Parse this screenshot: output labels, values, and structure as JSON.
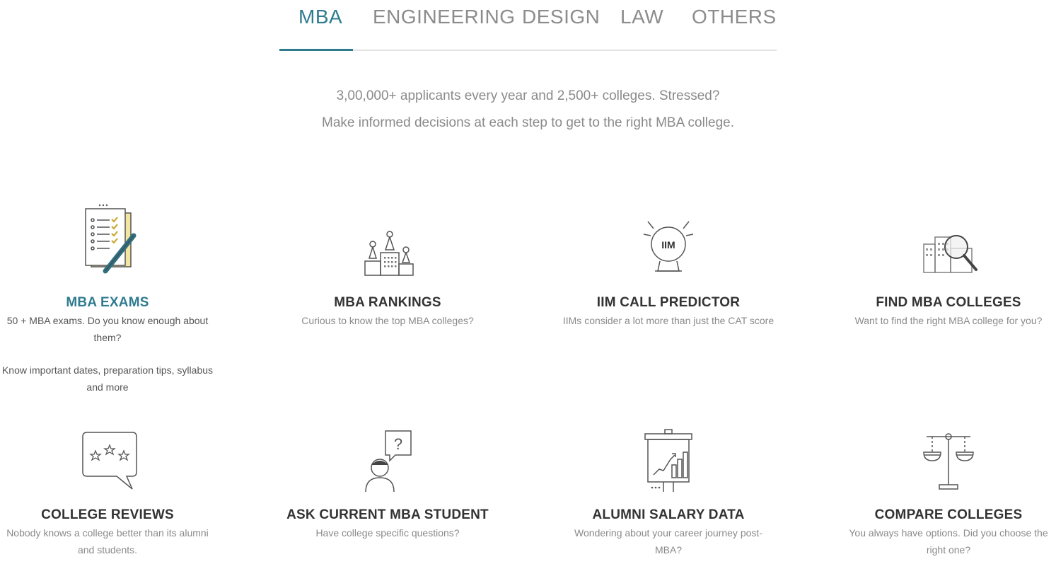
{
  "tabs": [
    {
      "label": "MBA",
      "active": true
    },
    {
      "label": "ENGINEERING",
      "active": false
    },
    {
      "label": "DESIGN",
      "active": false
    },
    {
      "label": "LAW",
      "active": false
    },
    {
      "label": "OTHERS",
      "active": false
    }
  ],
  "tagline": {
    "line1": "3,00,000+ applicants every year and 2,500+ colleges. Stressed?",
    "line2": "Make informed decisions at each step to get to the right MBA college."
  },
  "cards": [
    {
      "title": "MBA EXAMS",
      "desc": "50 + MBA exams. Do you know enough about them?",
      "desc2": "Know important dates, preparation tips, syllabus and more",
      "icon": "checklist-pencil-icon"
    },
    {
      "title": "MBA RANKINGS",
      "desc": "Curious to know the top MBA colleges?",
      "icon": "podium-trophy-icon"
    },
    {
      "title": "IIM CALL PREDICTOR",
      "desc": "IIMs consider a lot more than just the CAT score",
      "icon": "crystal-ball-icon",
      "icon_text": "IIM"
    },
    {
      "title": "FIND MBA COLLEGES",
      "desc": "Want to find the right MBA college for you?",
      "icon": "building-magnifier-icon"
    },
    {
      "title": "COLLEGE REVIEWS",
      "desc": "Nobody knows a college better than its alumni and students.",
      "icon": "speech-stars-icon"
    },
    {
      "title": "ASK CURRENT MBA STUDENT",
      "desc": "Have college specific questions?",
      "icon": "person-question-icon",
      "icon_text": "?"
    },
    {
      "title": "ALUMNI SALARY DATA",
      "desc": "Wondering about your career journey post-MBA?",
      "icon": "presentation-chart-icon"
    },
    {
      "title": "COMPARE COLLEGES",
      "desc": "You always have options. Did you choose the right one?",
      "icon": "balance-scale-icon"
    }
  ],
  "colors": {
    "accent": "#2f7b8f",
    "text": "#333333",
    "muted": "#8a8a8a",
    "icon_yellow": "#e8c84a"
  }
}
